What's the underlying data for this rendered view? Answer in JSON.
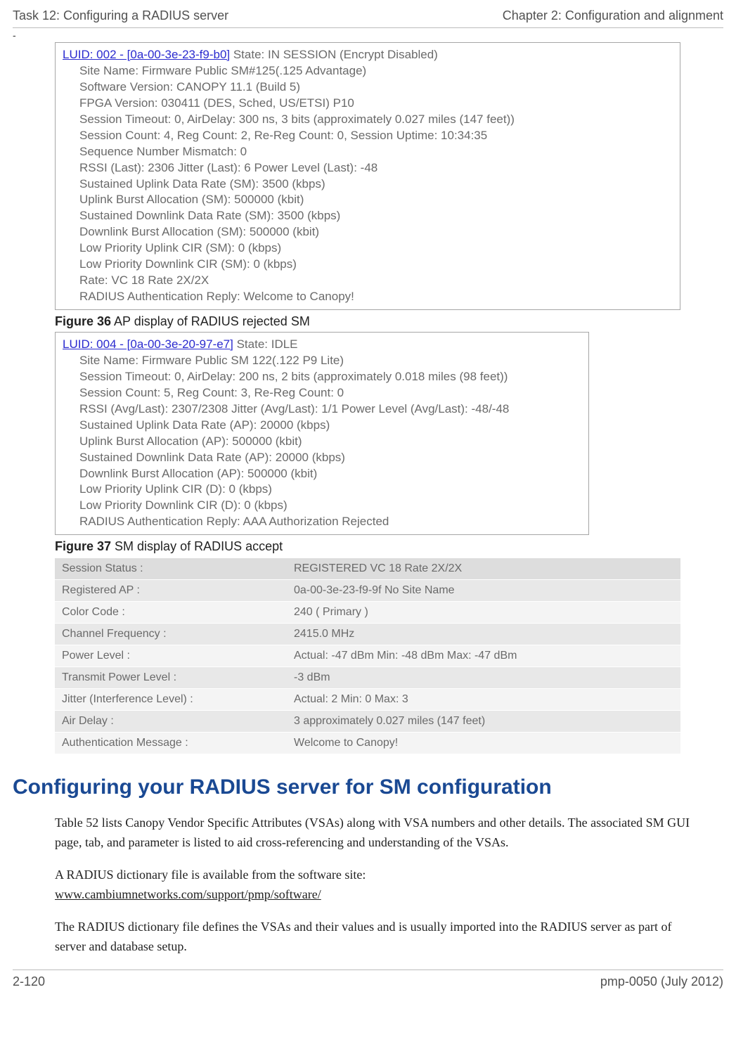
{
  "header": {
    "left": "Task 12: Configuring a RADIUS server",
    "right": "Chapter 2:  Configuration and alignment"
  },
  "dash": "-",
  "figures": {
    "f36": {
      "bold": "Figure 36",
      "rest": " AP display of RADIUS rejected SM"
    },
    "f37": {
      "bold": "Figure 37",
      "rest": " SM display of RADIUS accept"
    }
  },
  "shot1": {
    "luidText": "LUID: 002 - [0a-00-3e-23-f9-b0]",
    "stateText": " State: IN SESSION (Encrypt Disabled)",
    "lines": [
      "Site Name: Firmware Public SM#125(.125 Advantage)",
      "Software Version: CANOPY 11.1 (Build 5)",
      "FPGA Version: 030411 (DES, Sched, US/ETSI) P10",
      "Session Timeout: 0, AirDelay: 300 ns, 3 bits (approximately 0.027 miles (147 feet))",
      "Session Count: 4, Reg Count: 2, Re-Reg Count: 0, Session Uptime: 10:34:35",
      "Sequence Number Mismatch: 0",
      "RSSI (Last): 2306   Jitter (Last): 6   Power Level (Last): -48",
      "Sustained Uplink Data Rate (SM): 3500 (kbps)",
      "Uplink Burst Allocation (SM): 500000 (kbit)",
      "Sustained Downlink Data Rate (SM): 3500 (kbps)",
      "Downlink Burst Allocation (SM): 500000 (kbit)",
      "Low Priority Uplink CIR (SM): 0 (kbps)",
      "Low Priority Downlink CIR (SM): 0 (kbps)",
      "Rate: VC 18 Rate 2X/2X",
      "RADIUS Authentication Reply: Welcome to Canopy!"
    ]
  },
  "shot2": {
    "luidText": "LUID: 004 - [0a-00-3e-20-97-e7]",
    "stateText": " State: IDLE",
    "lines": [
      "Site Name: Firmware Public SM 122(.122 P9 Lite)",
      "Session Timeout: 0, AirDelay: 200 ns, 2 bits (approximately 0.018 miles (98 feet))",
      "Session Count: 5, Reg Count: 3, Re-Reg Count: 0",
      "RSSI (Avg/Last): 2307/2308   Jitter (Avg/Last): 1/1   Power Level (Avg/Last): -48/-48",
      "Sustained Uplink Data Rate (AP): 20000 (kbps)",
      "Uplink Burst Allocation (AP): 500000 (kbit)",
      "Sustained Downlink Data Rate (AP): 20000 (kbps)",
      "Downlink Burst Allocation (AP): 500000 (kbit)",
      "Low Priority Uplink CIR (D): 0 (kbps)",
      "Low Priority Downlink CIR (D): 0 (kbps)",
      "RADIUS Authentication Reply: AAA Authorization Rejected"
    ]
  },
  "statusTable": [
    {
      "label": "Session Status :",
      "value": "REGISTERED VC 18 Rate 2X/2X"
    },
    {
      "label": "Registered AP :",
      "value": "0a-00-3e-23-f9-9f No Site Name"
    },
    {
      "label": "Color Code :",
      "value": "240 ( Primary )"
    },
    {
      "label": "Channel Frequency :",
      "value": "2415.0 MHz"
    },
    {
      "label": "Power Level :",
      "value": "Actual: -47 dBm Min: -48 dBm Max: -47 dBm"
    },
    {
      "label": "Transmit Power Level :",
      "value": "-3 dBm"
    },
    {
      "label": "Jitter (Interference Level) :",
      "value": "Actual: 2 Min: 0 Max: 3"
    },
    {
      "label": "Air Delay :",
      "value": "3 approximately 0.027 miles (147 feet)"
    },
    {
      "label": "Authentication Message :",
      "value": "Welcome to Canopy!"
    }
  ],
  "section": {
    "title": "Configuring your RADIUS server for SM configuration",
    "p1": "Table 52 lists Canopy Vendor Specific Attributes (VSAs) along with VSA numbers and other details. The associated SM GUI page, tab, and parameter is listed to aid cross-referencing and understanding of the VSAs.",
    "p2a": "A RADIUS dictionary file is available from the software site:",
    "p2link": "www.cambiumnetworks.com/support/pmp/software/",
    "p3": "The RADIUS dictionary file defines the VSAs and their values and is usually imported into the RADIUS server as part of server and database setup."
  },
  "footer": {
    "left": "2-120",
    "right": "pmp-0050 (July 2012)"
  }
}
